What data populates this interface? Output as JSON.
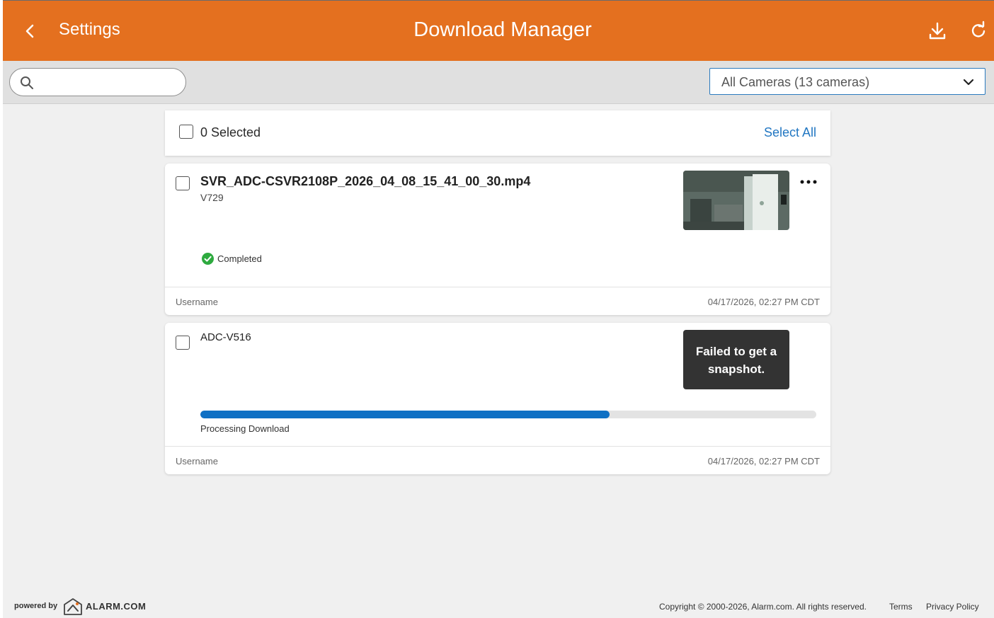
{
  "header": {
    "back_label": "Settings",
    "title": "Download Manager",
    "icons": [
      "chevron-left-icon",
      "download-icon",
      "refresh-icon"
    ],
    "color": "#e4701f"
  },
  "toolbar": {
    "search_value": "",
    "camera_filter": "All Cameras (13 cameras)"
  },
  "selection": {
    "count_label": "0 Selected",
    "select_all_label": "Select All"
  },
  "downloads": [
    {
      "title": "SVR_ADC-CSVR2108P_2026_04_08_15_41_00_30.mp4",
      "subtitle": "V729",
      "status": "Completed",
      "status_color": "#2eaa3f",
      "user": "Username",
      "timestamp": "04/17/2026, 02:27 PM CDT"
    },
    {
      "title": "ADC-V516",
      "snapshot_error": "Failed to get a snapshot.",
      "progress_label": "Processing Download",
      "progress_fraction": 0.664,
      "progress_color": "#0f70c4",
      "user": "Username",
      "timestamp": "04/17/2026, 02:27 PM CDT"
    }
  ],
  "footer": {
    "powered_by": "powered by",
    "brand": "ALARM.COM",
    "copyright": "Copyright © 2000-2026, Alarm.com. All rights reserved.",
    "terms": "Terms",
    "privacy": "Privacy Policy"
  }
}
